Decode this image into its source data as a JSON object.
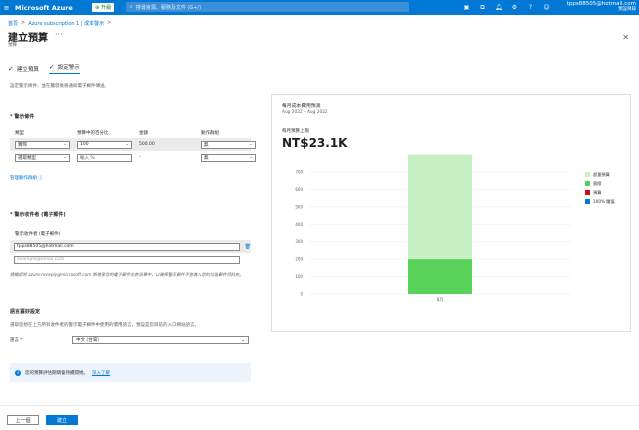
{
  "topbar": {
    "menu_icon": "≡",
    "brand": "Microsoft Azure",
    "upgrade_label": "升級",
    "search_placeholder": "搜尋資源、服務及文件 (G+/)",
    "account_email": "tpps88505@hotmail.com",
    "account_directory": "預設目錄",
    "icons": [
      "cloud-shell-icon",
      "portal-menu-icon",
      "notifications-icon",
      "settings-icon",
      "help-icon",
      "feedback-icon"
    ]
  },
  "breadcrumb": [
    "首頁",
    "Azure subscription 1 | 成本警示"
  ],
  "page": {
    "title": "建立預算",
    "subtitle": "預算",
    "more": "···",
    "close": "✕"
  },
  "steps": [
    "建立預算",
    "設定警示"
  ],
  "description": "設定警示條件，並在觸發後將通知電子郵件傳送。",
  "conditions": {
    "title": "警示條件",
    "headers": [
      "類型",
      "預算中的百分比",
      "金額",
      "動作群組"
    ],
    "rows": [
      {
        "type": "實際",
        "percent": "100",
        "amount": "500.00",
        "action": "無"
      },
      {
        "type": "選取類型",
        "percent": "輸入 %",
        "amount": "-",
        "action": "無"
      }
    ],
    "manage_link": "管理動作群組"
  },
  "alert_recipients": {
    "title": "警示收件者 (電子郵件)",
    "label": "警示收件者 (電子郵件)",
    "emails": [
      "tpps88505@hotmail.com"
    ],
    "placeholder": "example@email.com",
    "note": "請確認將 azure-noreply@microsoft.com 新增至您的電子郵件允許清單中，以確保警示郵件不會進入您的垃圾郵件資料夾。"
  },
  "language": {
    "title": "語言喜好設定",
    "description": "選取您想在上方所有收件者的警示電子郵件中使用的慣用語言，預設是您目前的入口網站語言。",
    "label": "語言 *",
    "value": "中文 (台灣)"
  },
  "info_bar": {
    "text": "您的預算評估期間會持續開始。",
    "link": "深入了解"
  },
  "footer": {
    "prev": "上一個",
    "create": "建立"
  },
  "chart_panel": {
    "title": "每月成本費用預測",
    "range": "Aug 2022 - Aug 2022",
    "metric_label": "每月預算上限",
    "metric_value": "NT$23.1K"
  },
  "chart_data": {
    "type": "bar",
    "categories": [
      "8月"
    ],
    "series": [
      {
        "name": "超量預算",
        "color": "#c7efc4",
        "values": [
          600
        ]
      },
      {
        "name": "實際",
        "color": "#57d157",
        "values": [
          200
        ]
      }
    ],
    "threshold_series": [
      {
        "name": "預算",
        "color": "#c50f1f"
      },
      {
        "name": "100% 閾值",
        "color": "#0078d4"
      }
    ],
    "yticks": [
      0,
      100,
      200,
      300,
      400,
      500,
      600,
      700
    ],
    "ylim": [
      0,
      700
    ]
  }
}
